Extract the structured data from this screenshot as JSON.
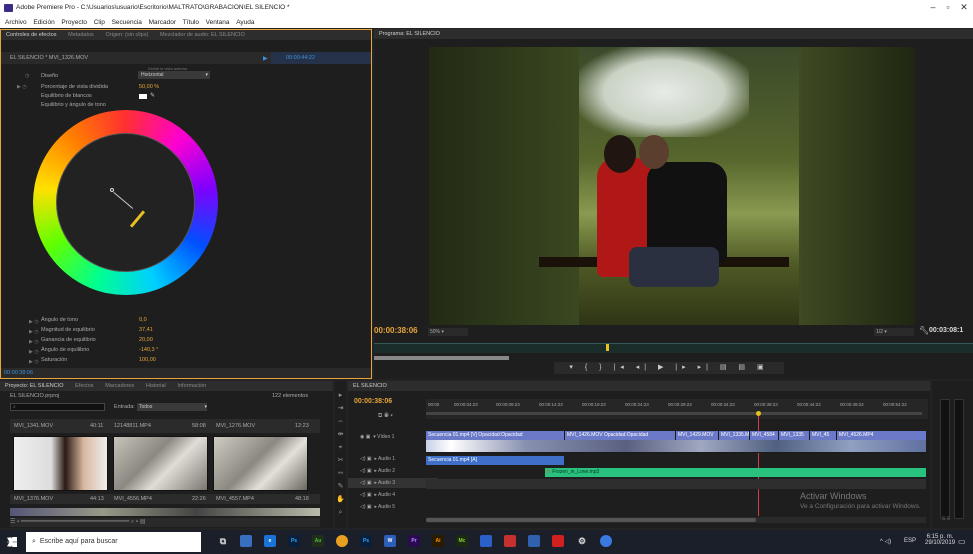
{
  "window": {
    "title": "Adobe Premiere Pro - C:\\Usuarios\\usuario\\Escritorio\\MALTRATO\\GRABACION\\EL SILENCIO *"
  },
  "menu": [
    "Archivo",
    "Edición",
    "Proyecto",
    "Clip",
    "Secuencia",
    "Marcador",
    "Título",
    "Ventana",
    "Ayuda"
  ],
  "effects_panel": {
    "tabs": [
      "Controles de efectos",
      "Metadatos",
      "Origen: (sin clips)",
      "Mezclador de audio: EL SILENCIO"
    ],
    "clip_label": "EL SILENCIO * MVI_1326.MOV",
    "timecode": "00:00:44:22",
    "props_top": [
      {
        "name": "Diseño",
        "value": "Horizontal"
      },
      {
        "name": "Porcentaje de vista dividida",
        "value": "50,00 %"
      },
      {
        "name": "Equilibrio de blancos",
        "value": ""
      },
      {
        "name": "Equilibrio y ángulo de tono",
        "value": ""
      }
    ],
    "hidden_label": "Dividir la vista anterior",
    "props_bottom": [
      {
        "name": "Ángulo de tono",
        "value": "0,0"
      },
      {
        "name": "Magnitud de equilibrio",
        "value": "37,41"
      },
      {
        "name": "Ganancia de equilibrio",
        "value": "20,00"
      },
      {
        "name": "Ángulo de equilibrio",
        "value": "-140,3 °"
      },
      {
        "name": "Saturación",
        "value": "100,00"
      }
    ],
    "bottom_timecode": "00:00:38:06"
  },
  "program_monitor": {
    "tab": "Programa: EL SILENCIO",
    "current_time": "00:00:38:06",
    "zoom": "50%",
    "quality": "1/2",
    "duration": "00:03:08:1"
  },
  "project_panel": {
    "tabs": [
      "Proyecto: EL SILENCIO",
      "Efectos",
      "Marcadores",
      "Historial",
      "Información"
    ],
    "project_name": "EL SILENCIO.prproj",
    "item_count": "122 elementos",
    "input_label": "Entrada:",
    "input_value": "Todos",
    "row1": [
      {
        "name": "MVI_1341.MOV",
        "dur": "40:11"
      },
      {
        "name": "12148811.MP4",
        "dur": "58:08"
      },
      {
        "name": "MVI_1276.MOV",
        "dur": "12:23"
      }
    ],
    "row2": [
      {
        "name": "MVI_1376.MOV",
        "dur": "44:13"
      },
      {
        "name": "MVI_4556.MP4",
        "dur": "22:26"
      },
      {
        "name": "MVI_4557.MP4",
        "dur": "48:18"
      }
    ]
  },
  "timeline": {
    "tab": "EL SILENCIO",
    "timecode": "00:00:38:06",
    "ruler": [
      "00:00",
      "00:00:04:23",
      "00:00:09:23",
      "00:00:14:23",
      "00:00:19:23",
      "00:00:24:23",
      "00:00:29:23",
      "00:00:34:23",
      "00:00:39:23",
      "00:00:44:22",
      "00:00:49:22",
      "00:00:54:22"
    ],
    "tracks": [
      "Vídeo 1",
      "Audio 1",
      "Audio 2",
      "Audio 3",
      "Audio 4",
      "Audio 5"
    ],
    "video_clips": [
      "Secuencia 01.mp4 [V] Opacidad:Opacidad",
      "MVI_1426.MOV Opacidad:Opacidad",
      "MVI_1429.MOV",
      "MVI_1335.M",
      "MVI_4584",
      "MVI_1335",
      "MVI_45",
      "MVI_4526.MP4"
    ],
    "audio1_clip": "Secuencia 01.mp4 [A]",
    "audio2_clip": "Frozen_in_Love.mp3"
  },
  "watermark": {
    "title": "Activar Windows",
    "sub": "Ve a Configuración para activar Windows."
  },
  "taskbar": {
    "search": "Escribe aquí para buscar",
    "lang": "ESP",
    "time": "6:15 p. m.",
    "date": "29/10/2019"
  }
}
